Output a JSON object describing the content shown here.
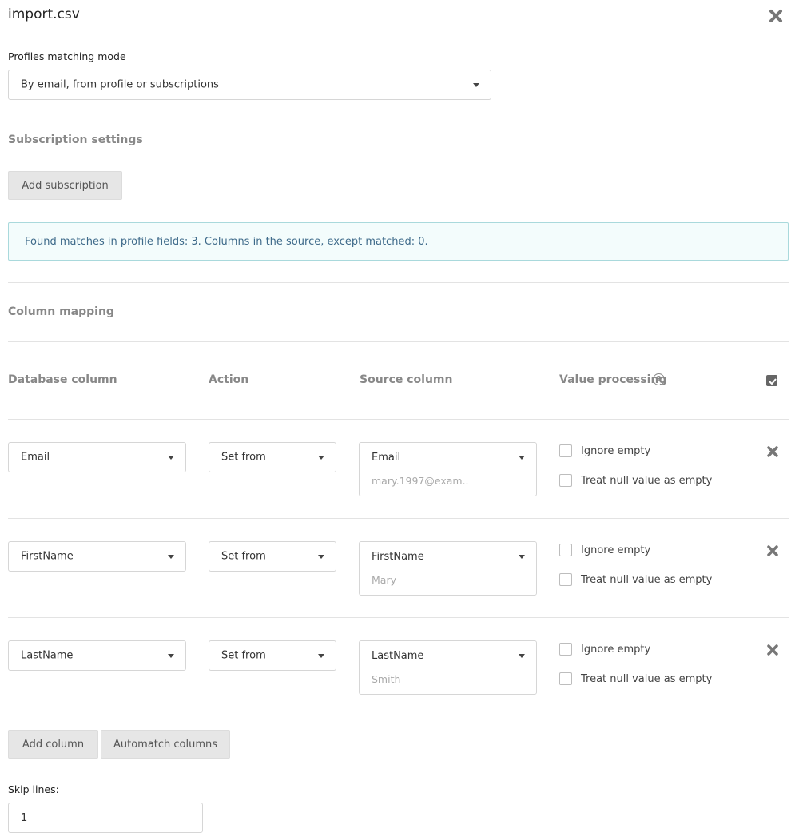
{
  "header": {
    "title": "import.csv"
  },
  "matching": {
    "label": "Profiles matching mode",
    "selected": "By email, from profile or subscriptions"
  },
  "subscription": {
    "title": "Subscription settings",
    "add_label": "Add subscription"
  },
  "info": {
    "text": "Found matches in profile fields: 3. Columns in the source, except matched: 0."
  },
  "mapping": {
    "title": "Column mapping",
    "headers": {
      "db": "Database column",
      "action": "Action",
      "source": "Source column",
      "processing": "Value processing"
    },
    "help_glyph": "?",
    "rows": [
      {
        "db": "Email",
        "action": "Set from",
        "source": "Email",
        "sample": "mary.1997@exam..",
        "ignore_empty": "Ignore empty",
        "treat_null": "Treat null value as empty"
      },
      {
        "db": "FirstName",
        "action": "Set from",
        "source": "FirstName",
        "sample": "Mary",
        "ignore_empty": "Ignore empty",
        "treat_null": "Treat null value as empty"
      },
      {
        "db": "LastName",
        "action": "Set from",
        "source": "LastName",
        "sample": "Smith",
        "ignore_empty": "Ignore empty",
        "treat_null": "Treat null value as empty"
      }
    ]
  },
  "buttons": {
    "add_column": "Add column",
    "automatch": "Automatch columns"
  },
  "skip": {
    "label": "Skip lines:",
    "value": "1"
  },
  "icons": {
    "close": "close-x-icon",
    "dropdown": "caret-down-icon",
    "help": "question-circle-icon",
    "check": "checkmark-icon"
  },
  "colors": {
    "info_bg": "#f3fcfc",
    "info_border": "#a9d9dc",
    "info_text": "#3e6a8a"
  }
}
